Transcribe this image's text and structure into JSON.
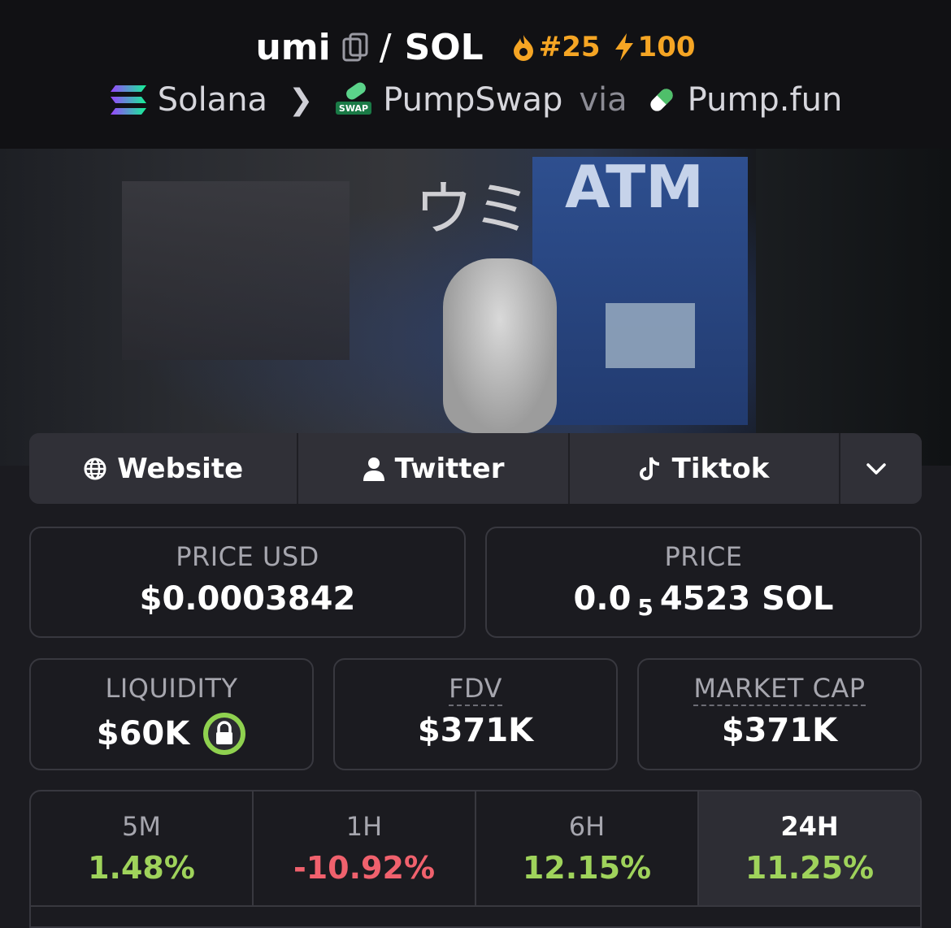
{
  "header": {
    "base_token": "umi",
    "separator": "/",
    "quote_token": "SOL",
    "rank_badge": "#25",
    "boost_badge": "100",
    "chain": "Solana",
    "dex": "PumpSwap",
    "via_label": "via",
    "launchpad": "Pump.fun",
    "swap_badge_text": "SWAP"
  },
  "banner": {
    "jp_text": "ウミ",
    "atm_text": "ATM"
  },
  "links": [
    {
      "label": "Website",
      "icon": "globe-icon"
    },
    {
      "label": "Twitter",
      "icon": "user-icon"
    },
    {
      "label": "Tiktok",
      "icon": "tiktok-icon"
    }
  ],
  "stats": {
    "price_usd": {
      "label": "PRICE USD",
      "value": "$0.0003842"
    },
    "price": {
      "label": "PRICE",
      "prefix": "0.0",
      "zeros": "5",
      "suffix": "4523 SOL"
    },
    "liquidity": {
      "label": "LIQUIDITY",
      "value": "$60K"
    },
    "fdv": {
      "label": "FDV",
      "value": "$371K"
    },
    "market_cap": {
      "label": "MARKET CAP",
      "value": "$371K"
    }
  },
  "changes": [
    {
      "label": "5M",
      "value": "1.48%",
      "direction": "up"
    },
    {
      "label": "1H",
      "value": "-10.92%",
      "direction": "down"
    },
    {
      "label": "6H",
      "value": "12.15%",
      "direction": "up"
    },
    {
      "label": "24H",
      "value": "11.25%",
      "direction": "up",
      "selected": true
    }
  ],
  "colors": {
    "accent": "#f5a524",
    "positive": "#9fd35b",
    "negative": "#f0616d",
    "lock_ring": "#8fd14f"
  }
}
